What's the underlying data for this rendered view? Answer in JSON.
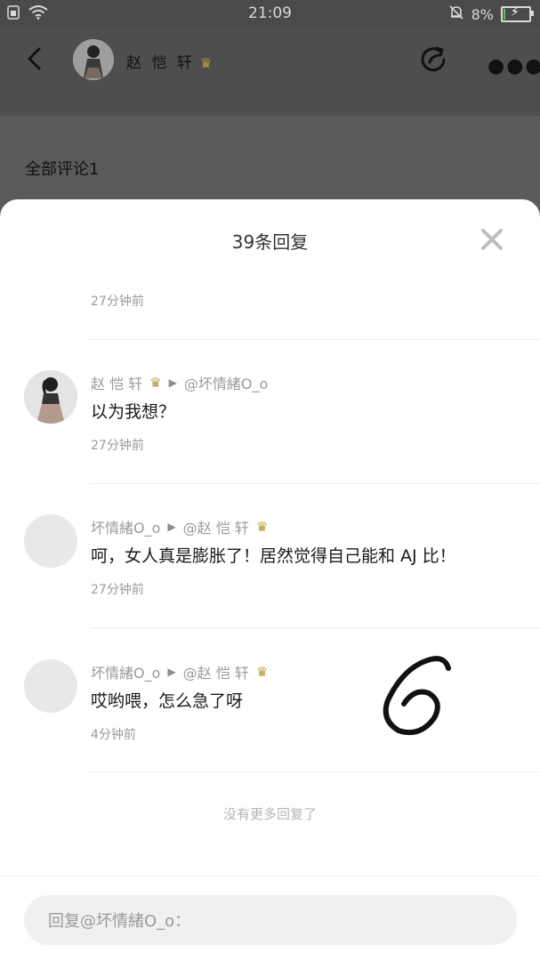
{
  "status_bar": {
    "time": "21:09",
    "battery_percent": "8%",
    "battery_level": 0.08,
    "icons": [
      "sim-icon",
      "wifi-icon",
      "mute-bell-icon",
      "battery-charging-icon"
    ]
  },
  "header": {
    "user_name": "赵 恺 轩",
    "badge_icon": "lotus-crown-icon",
    "icons": [
      "back-arrow-icon",
      "share-icon",
      "more-icon"
    ]
  },
  "comments_section": {
    "title": "全部评论1"
  },
  "sheet": {
    "title": "39条回复",
    "top_time": "27分钟前",
    "replies": [
      {
        "author": "赵 恺 轩",
        "target": "@坏情緒O_o",
        "text": "以为我想？",
        "time": "27分钟前"
      },
      {
        "author": "坏情緒O_o",
        "target": "@赵 恺 轩",
        "text": "呵，女人真是膨胀了！居然觉得自己能和 AJ 比！",
        "time": "27分钟前"
      },
      {
        "author": "坏情緒O_o",
        "target": "@赵 恺 轩",
        "text": "哎哟喂，怎么急了呀",
        "time": "4分钟前"
      }
    ],
    "no_more": "没有更多回复了",
    "input_placeholder": "回复@坏情緒O_o："
  },
  "colors": {
    "battery_green": "#57c65a",
    "badge_gold": "#c9a640"
  }
}
